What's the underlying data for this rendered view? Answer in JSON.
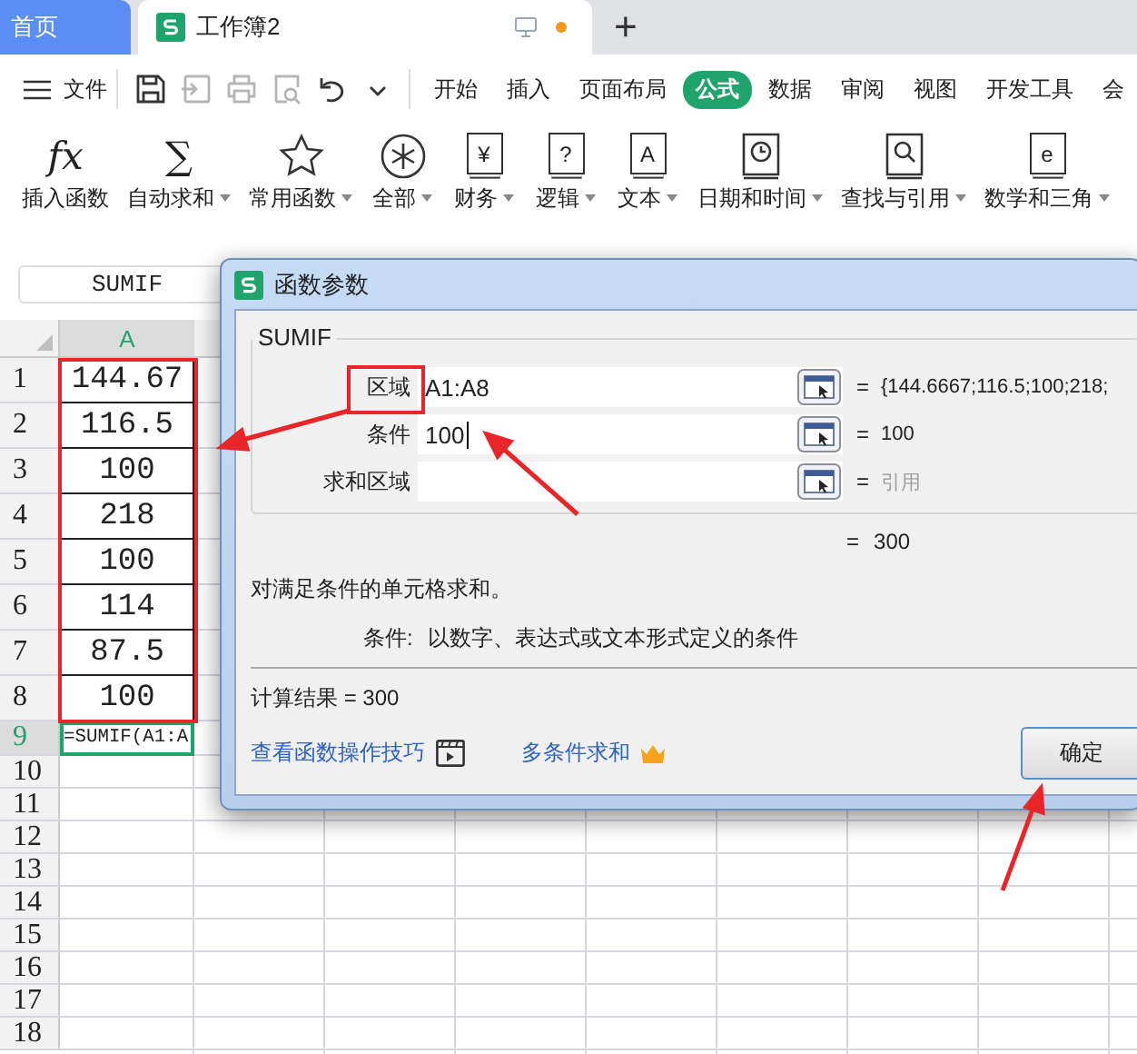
{
  "tabs": [
    {
      "label": "首页",
      "kind": "home",
      "selected": false
    },
    {
      "label": "工作簿2",
      "kind": "workbook",
      "selected": true,
      "modified": true
    }
  ],
  "new_tab": "+",
  "menu": {
    "file": "文件",
    "quick_access": [
      {
        "kind": "save",
        "disabled": false
      },
      {
        "kind": "export",
        "disabled": true
      },
      {
        "kind": "print",
        "disabled": true
      },
      {
        "kind": "preview",
        "disabled": true
      },
      {
        "kind": "undo",
        "disabled": false
      },
      {
        "kind": "more",
        "disabled": false
      }
    ],
    "items": [
      {
        "label": "开始",
        "selected": false
      },
      {
        "label": "插入",
        "selected": false
      },
      {
        "label": "页面布局",
        "selected": false
      },
      {
        "label": "公式",
        "selected": true
      },
      {
        "label": "数据",
        "selected": false
      },
      {
        "label": "审阅",
        "selected": false
      },
      {
        "label": "视图",
        "selected": false
      },
      {
        "label": "开发工具",
        "selected": false
      },
      {
        "label": "会",
        "selected": false
      }
    ]
  },
  "ribbon": [
    {
      "label": "插入函数",
      "kind": "plain",
      "glyph": "fx",
      "dropdown": false
    },
    {
      "label": "自动求和",
      "kind": "plain",
      "glyph": "∑",
      "dropdown": true
    },
    {
      "label": "常用函数",
      "kind": "star",
      "dropdown": true
    },
    {
      "label": "全部",
      "kind": "asterisk",
      "dropdown": true
    },
    {
      "label": "财务",
      "kind": "book",
      "glyph": "¥",
      "dropdown": true
    },
    {
      "label": "逻辑",
      "kind": "book",
      "glyph": "?",
      "dropdown": true
    },
    {
      "label": "文本",
      "kind": "book",
      "glyph": "A",
      "dropdown": true
    },
    {
      "label": "日期和时间",
      "kind": "clock",
      "dropdown": true
    },
    {
      "label": "查找与引用",
      "kind": "search",
      "dropdown": true
    },
    {
      "label": "数学和三角",
      "kind": "book",
      "glyph": "e",
      "dropdown": true
    }
  ],
  "name_box": "SUMIF",
  "sheet": {
    "column": "A",
    "rows": [
      {
        "row": "1",
        "value": "144.67",
        "selected": false
      },
      {
        "row": "2",
        "value": "116.5",
        "selected": false
      },
      {
        "row": "3",
        "value": "100",
        "selected": false
      },
      {
        "row": "4",
        "value": "218",
        "selected": false
      },
      {
        "row": "5",
        "value": "100",
        "selected": false
      },
      {
        "row": "6",
        "value": "114",
        "selected": false
      },
      {
        "row": "7",
        "value": "87.5",
        "selected": false
      },
      {
        "row": "8",
        "value": "100",
        "selected": false
      },
      {
        "row": "9",
        "value": "=SUMIF(A1:A",
        "selected": true
      },
      {
        "row": "10",
        "selected": false
      },
      {
        "row": "11",
        "selected": false
      },
      {
        "row": "12",
        "selected": false
      },
      {
        "row": "13",
        "selected": false
      },
      {
        "row": "14",
        "selected": false
      },
      {
        "row": "15",
        "selected": false
      },
      {
        "row": "16",
        "selected": false
      },
      {
        "row": "17",
        "selected": false
      },
      {
        "row": "18",
        "selected": false
      }
    ]
  },
  "dialog": {
    "title": "函数参数",
    "function": "SUMIF",
    "arguments": [
      {
        "label": "区域",
        "value": "A1:A8",
        "equals": "=",
        "result": "{144.6667;116.5;100;218;",
        "dim": false,
        "focused": false
      },
      {
        "label": "条件",
        "value": "100",
        "equals": "=",
        "result": "100",
        "dim": false,
        "focused": true
      },
      {
        "label": "求和区域",
        "equals": "=",
        "result": "引用",
        "dim": true,
        "focused": false
      }
    ],
    "total": {
      "equals": "=",
      "value": "300"
    },
    "description": "对满足条件的单元格求和。",
    "help": {
      "label": "条件:",
      "text": "以数字、表达式或文本形式定义的条件"
    },
    "calc_result": "计算结果 = 300",
    "links": [
      {
        "label": "查看函数操作技巧",
        "kind": "video"
      },
      {
        "label": "多条件求和",
        "kind": "crown"
      }
    ],
    "ok": "确定"
  }
}
